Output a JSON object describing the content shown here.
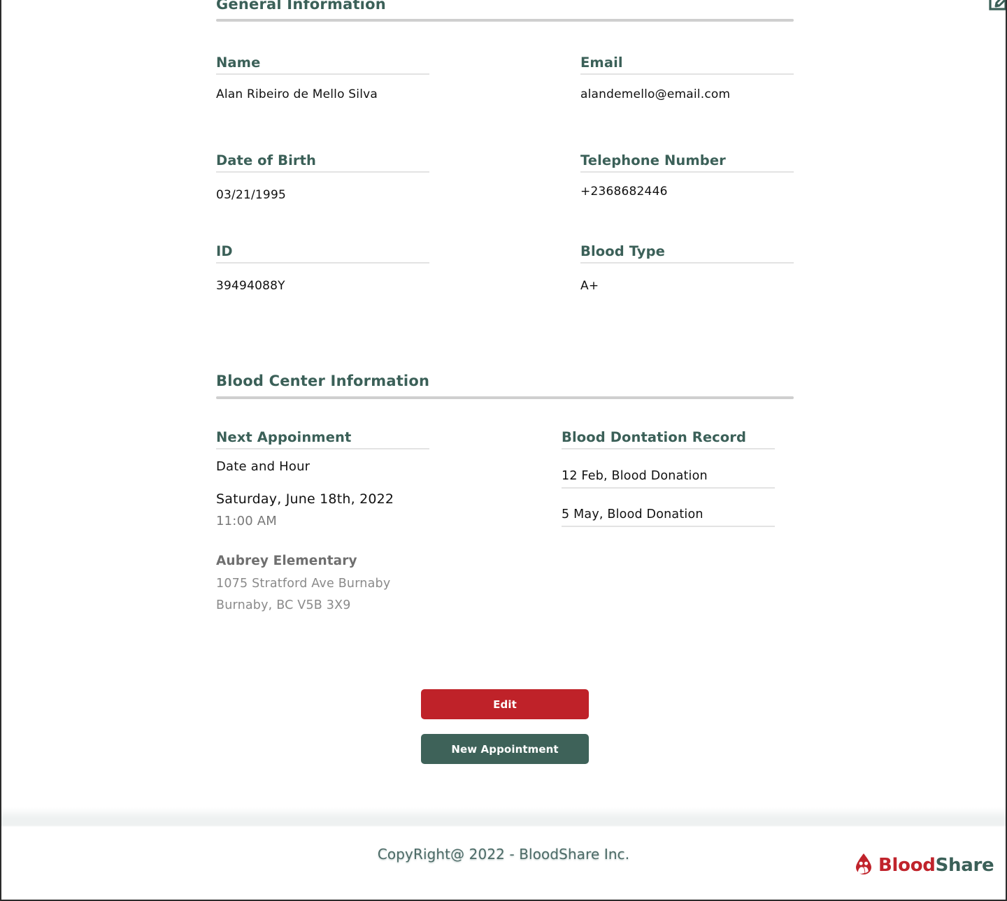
{
  "sections": {
    "general": {
      "title": "General Information",
      "edit_icon": "edit-pencil-square-icon",
      "fields": [
        {
          "label": "Name",
          "value": "Alan Ribeiro de Mello Silva"
        },
        {
          "label": "Email",
          "value": "alandemello@email.com"
        },
        {
          "label": "Date of Birth",
          "value": "03/21/1995"
        },
        {
          "label": "Telephone Number",
          "value": "+2368682446"
        },
        {
          "label": "ID",
          "value": "39494088Y"
        },
        {
          "label": "Blood Type",
          "value": "A+"
        }
      ]
    },
    "blood_center": {
      "title": "Blood Center Information",
      "next_appointment": {
        "label": "Next Appoinment",
        "sublabel": "Date and Hour",
        "date": "Saturday, June 18th, 2022",
        "time": "11:00 AM",
        "location_name": "Aubrey Elementary",
        "address_line1": "1075 Stratford Ave Burnaby",
        "address_line2": "Burnaby, BC V5B 3X9"
      },
      "donation_record": {
        "label": "Blood Dontation Record",
        "entries": [
          "12 Feb, Blood Donation",
          "5 May, Blood Donation"
        ]
      }
    }
  },
  "actions": {
    "edit_label": "Edit",
    "new_appointment_label": "New Appointment"
  },
  "footer": {
    "copyright": "CopyRight@ 2022 - BloodShare Inc.",
    "brand_first": "Blood",
    "brand_second": "Share",
    "brand_icon": "blood-drop-people-logo-icon"
  },
  "colors": {
    "teal": "#3b6058",
    "red": "#bf2229",
    "rule": "#cfcfcf",
    "field_rule": "#e3e3e3",
    "muted": "#8a8a8a"
  }
}
